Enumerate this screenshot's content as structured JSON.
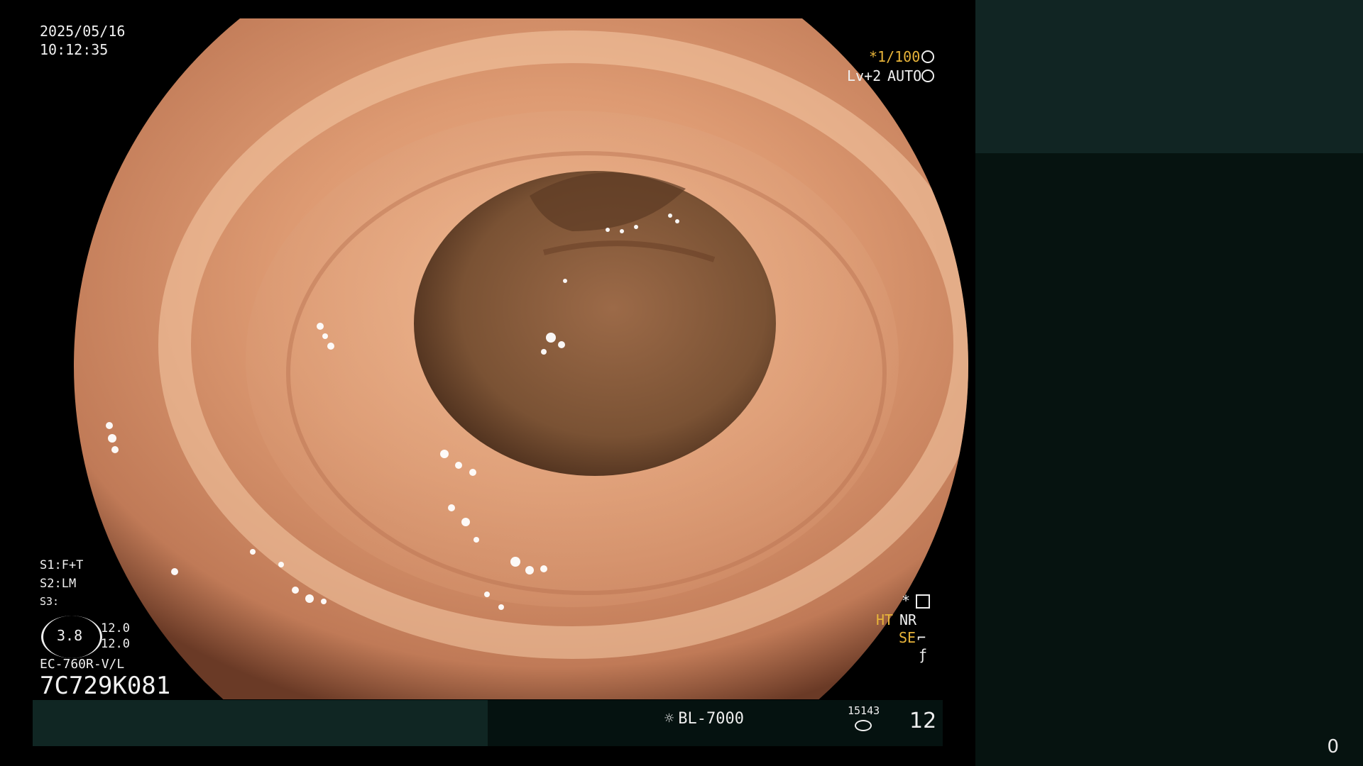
{
  "overlay": {
    "date": "2025/05/16",
    "time": "10:12:35",
    "shutter": "*1/100",
    "level": "Lv+2",
    "iris": "AUTO",
    "s1": "S1:F+T",
    "s2": "S2:LM",
    "s3": "S3:",
    "ring_value": "3.8",
    "ring_side_1": "12.0",
    "ring_side_2": "12.0",
    "scope_model": "EC-760R-V/L",
    "scope_serial": "7C729K081",
    "star_mark": "*",
    "ht": "HT",
    "nr": "NR",
    "se": "SE"
  },
  "bottom_bar": {
    "light_source": "BL-7000",
    "counter_small": "15143",
    "counter_big": "12"
  },
  "right_panel": {
    "frame_count": "0",
    "top_color": "#112523",
    "bottom_color": "#061310"
  },
  "icons": [
    "shutter-icon",
    "iris-icon",
    "enhance-icon",
    "se-icon",
    "mode-icon",
    "light-source-icon",
    "storage-icon"
  ],
  "colors": {
    "tissue": "#d8966f",
    "lumen": "#7a5234",
    "overlay_yellow": "#e8b43a"
  }
}
